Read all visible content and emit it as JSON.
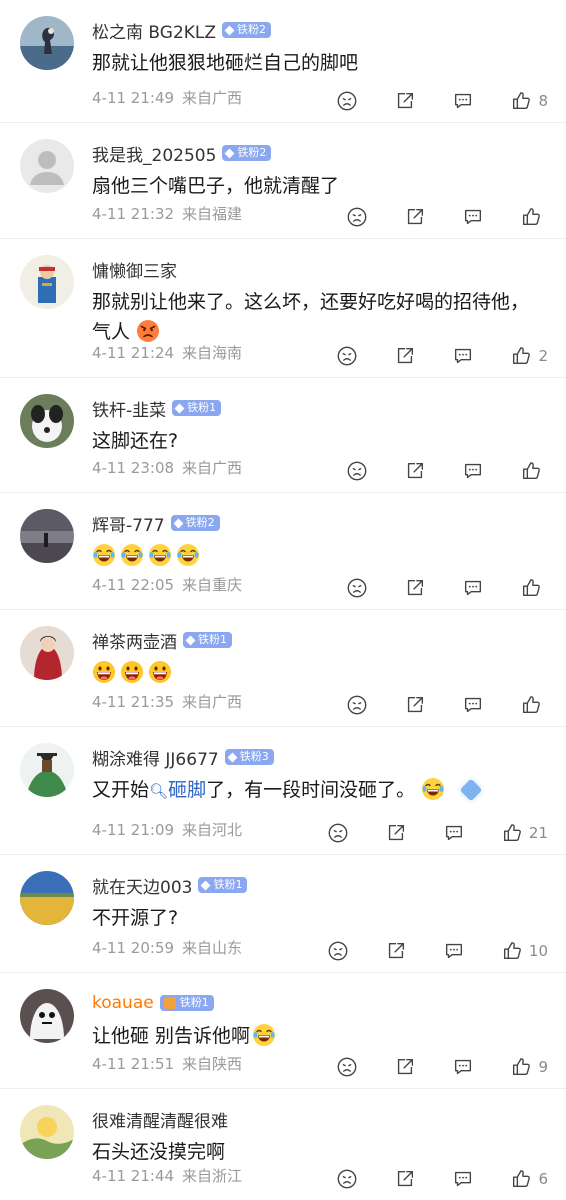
{
  "comments": [
    {
      "username": "松之南 BG2KLZ",
      "badge": "铁粉2",
      "lines": [
        "那就让他狠狠地砸烂自己的脚吧"
      ],
      "time": "4-11 21:49",
      "location": "来自广西",
      "likes": "8"
    },
    {
      "username": "我是我_202505",
      "badge": "铁粉2",
      "lines": [
        "扇他三个嘴巴子，他就清醒了"
      ],
      "time": "4-11 21:32",
      "location": "来自福建",
      "likes": ""
    },
    {
      "username": "慵懒御三家",
      "badge": "",
      "lines": [
        "那就别让他来了。这么坏，还要好吃好喝的招待他，",
        "气人"
      ],
      "time": "4-11 21:24",
      "location": "来自海南",
      "likes": "2"
    },
    {
      "username": "铁杆-韭菜",
      "badge": "铁粉1",
      "lines": [
        "这脚还在?"
      ],
      "time": "4-11 23:08",
      "location": "来自广西",
      "likes": ""
    },
    {
      "username": "辉哥-777",
      "badge": "铁粉2",
      "lines": [
        ""
      ],
      "time": "4-11 22:05",
      "location": "来自重庆",
      "likes": ""
    },
    {
      "username": "禅茶两壶酒",
      "badge": "铁粉1",
      "lines": [
        ""
      ],
      "time": "4-11 21:35",
      "location": "来自广西",
      "likes": ""
    },
    {
      "username": "糊涂难得 JJ6677",
      "badge": "铁粉3",
      "prefix": "又开始",
      "link": "砸脚",
      "suffix": "了，有一段时间没砸了。",
      "time": "4-11 21:09",
      "location": "来自河北",
      "likes": "21"
    },
    {
      "username": "就在天边003",
      "badge": "铁粉1",
      "lines": [
        "不开源了?"
      ],
      "time": "4-11 20:59",
      "location": "来自山东",
      "likes": "10"
    },
    {
      "username": "koauae",
      "badge": "铁粉1",
      "lines": [
        "让他砸 别告诉他啊"
      ],
      "time": "4-11 21:51",
      "location": "来自陕西",
      "likes": "9"
    },
    {
      "username": "很难清醒清醒很难",
      "badge": "",
      "lines": [
        "石头还没摸完啊"
      ],
      "time": "4-11 21:44",
      "location": "来自浙江",
      "likes": "6"
    }
  ],
  "icons": {
    "dislike": "dislike-face-icon",
    "share": "share-icon",
    "reply": "reply-bubble-icon",
    "like": "thumbs-up-icon",
    "laugh": "laugh-cry-emoji",
    "grin": "grin-emoji",
    "angry": "angry-emoji"
  },
  "colors": {
    "badge": "#8aa7ef",
    "link": "#2b64c5",
    "meta": "#9a9a9a",
    "orange_name": "#ff7a00"
  }
}
